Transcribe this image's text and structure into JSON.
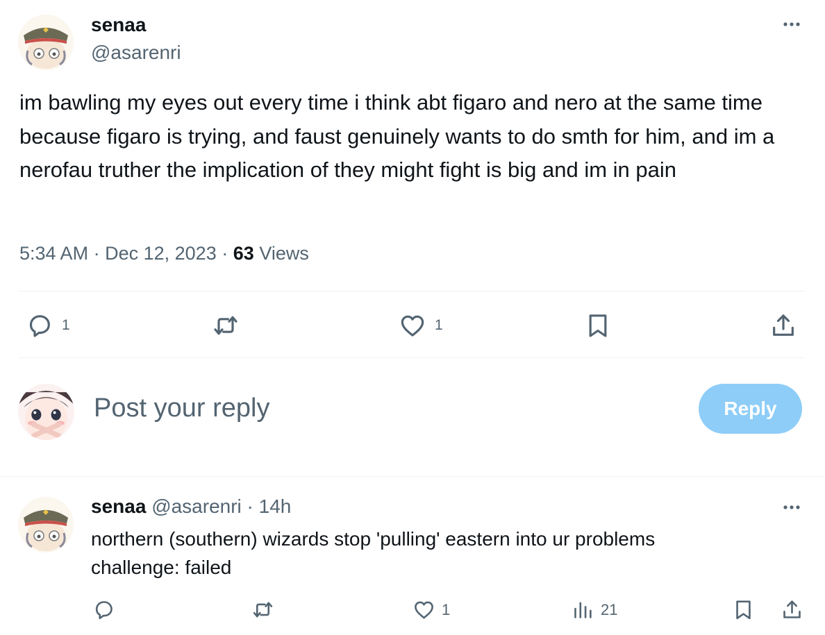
{
  "post": {
    "author": {
      "display_name": "senaa",
      "handle": "@asarenri",
      "avatar_icon": "hat-character-avatar"
    },
    "text": "im bawling my eyes out every time i think abt figaro and nero at the same time because figaro is trying, and faust genuinely wants to do smth for him, and im a nerofau truther the implication of they might fight is big and im in pain",
    "meta": {
      "time": "5:34 AM",
      "separator": "·",
      "date": "Dec 12, 2023",
      "views_count": "63",
      "views_label": "Views"
    },
    "actions": {
      "reply_icon": "reply-icon",
      "reply_count": "1",
      "repost_icon": "repost-icon",
      "like_icon": "heart-icon",
      "like_count": "1",
      "bookmark_icon": "bookmark-icon",
      "share_icon": "share-icon"
    }
  },
  "composer": {
    "placeholder": "Post your reply",
    "button_label": "Reply",
    "button_color": "#8ecdf8",
    "avatar_icon": "anime-girl-avatar"
  },
  "reply": {
    "author": {
      "display_name": "senaa",
      "handle": "@asarenri",
      "avatar_icon": "hat-character-avatar"
    },
    "time_ago": "14h",
    "header_meta": "@asarenri · 14h",
    "text_line1": "northern (southern) wizards stop 'pulling' eastern into ur problems",
    "text_line2": "challenge: failed",
    "actions": {
      "like_count": "1",
      "views_count": "21"
    }
  },
  "colors": {
    "text_primary": "#0f1419",
    "text_secondary": "#536471",
    "divider": "#eff3f4"
  }
}
